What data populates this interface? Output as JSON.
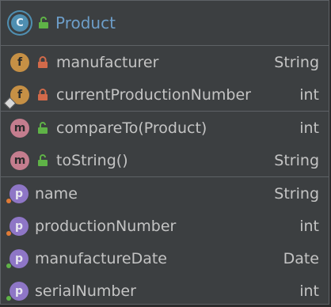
{
  "header": {
    "icon": "class-icon",
    "icon_letter": "C",
    "title": "Product"
  },
  "fields": [
    {
      "badge": "f",
      "name": "manufacturer",
      "type": "String",
      "access": "private"
    },
    {
      "badge": "f",
      "name": "currentProductionNumber",
      "type": "int",
      "access": "private"
    }
  ],
  "methods": [
    {
      "badge": "m",
      "name": "compareTo(Product)",
      "type": "int",
      "access": "public"
    },
    {
      "badge": "m",
      "name": "toString()",
      "type": "String",
      "access": "public"
    }
  ],
  "properties": [
    {
      "badge": "p",
      "name": "name",
      "type": "String"
    },
    {
      "badge": "p",
      "name": "productionNumber",
      "type": "int"
    },
    {
      "badge": "p",
      "name": "manufactureDate",
      "type": "Date"
    },
    {
      "badge": "p",
      "name": "serialNumber",
      "type": "int"
    }
  ],
  "colors": {
    "background": "#3c3f41",
    "border": "#5e6266",
    "title": "#6d9ec9",
    "field_badge": "#c69045",
    "method_badge": "#c47d8e",
    "property_badge": "#8e76c6",
    "lock_private": "#d26a4a",
    "lock_public": "#5fb347"
  }
}
